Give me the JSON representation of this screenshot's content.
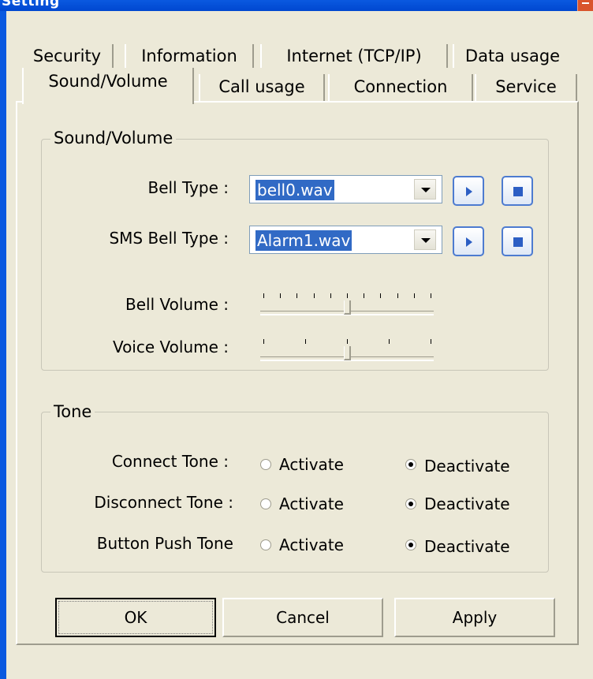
{
  "window": {
    "title": "Setting"
  },
  "tabs": {
    "row_back": [
      {
        "label": "Security"
      },
      {
        "label": "Information"
      },
      {
        "label": "Internet (TCP/IP)"
      },
      {
        "label": "Data usage"
      }
    ],
    "row_front": [
      {
        "label": "Sound/Volume",
        "active": true
      },
      {
        "label": "Call usage"
      },
      {
        "label": "Connection"
      },
      {
        "label": "Service"
      }
    ]
  },
  "sound_volume": {
    "group_label": "Sound/Volume",
    "bell_type": {
      "label": "Bell Type :",
      "value": "bell0.wav"
    },
    "sms_bell_type": {
      "label": "SMS Bell Type :",
      "value": "Alarm1.wav"
    },
    "bell_volume": {
      "label": "Bell Volume :",
      "level": 0.5,
      "tick_count": 11
    },
    "voice_volume": {
      "label": "Voice Volume :",
      "level": 0.5,
      "tick_count": 5
    }
  },
  "tone": {
    "group_label": "Tone",
    "rows": [
      {
        "label": "Connect Tone :",
        "activate": "Activate",
        "deactivate": "Deactivate",
        "selected": "deactivate"
      },
      {
        "label": "Disconnect Tone :",
        "activate": "Activate",
        "deactivate": "Deactivate",
        "selected": "deactivate"
      },
      {
        "label": "Button Push Tone",
        "activate": "Activate",
        "deactivate": "Deactivate",
        "selected": "deactivate"
      }
    ]
  },
  "buttons": {
    "ok": "OK",
    "cancel": "Cancel",
    "apply": "Apply"
  },
  "icons": {
    "play": "play-icon",
    "stop": "stop-icon",
    "dropdown": "chevron-down-icon",
    "close": "close-icon"
  },
  "colors": {
    "face": "#ece9d8",
    "selection": "#316ac5",
    "title_bar": "#0a59e0"
  }
}
